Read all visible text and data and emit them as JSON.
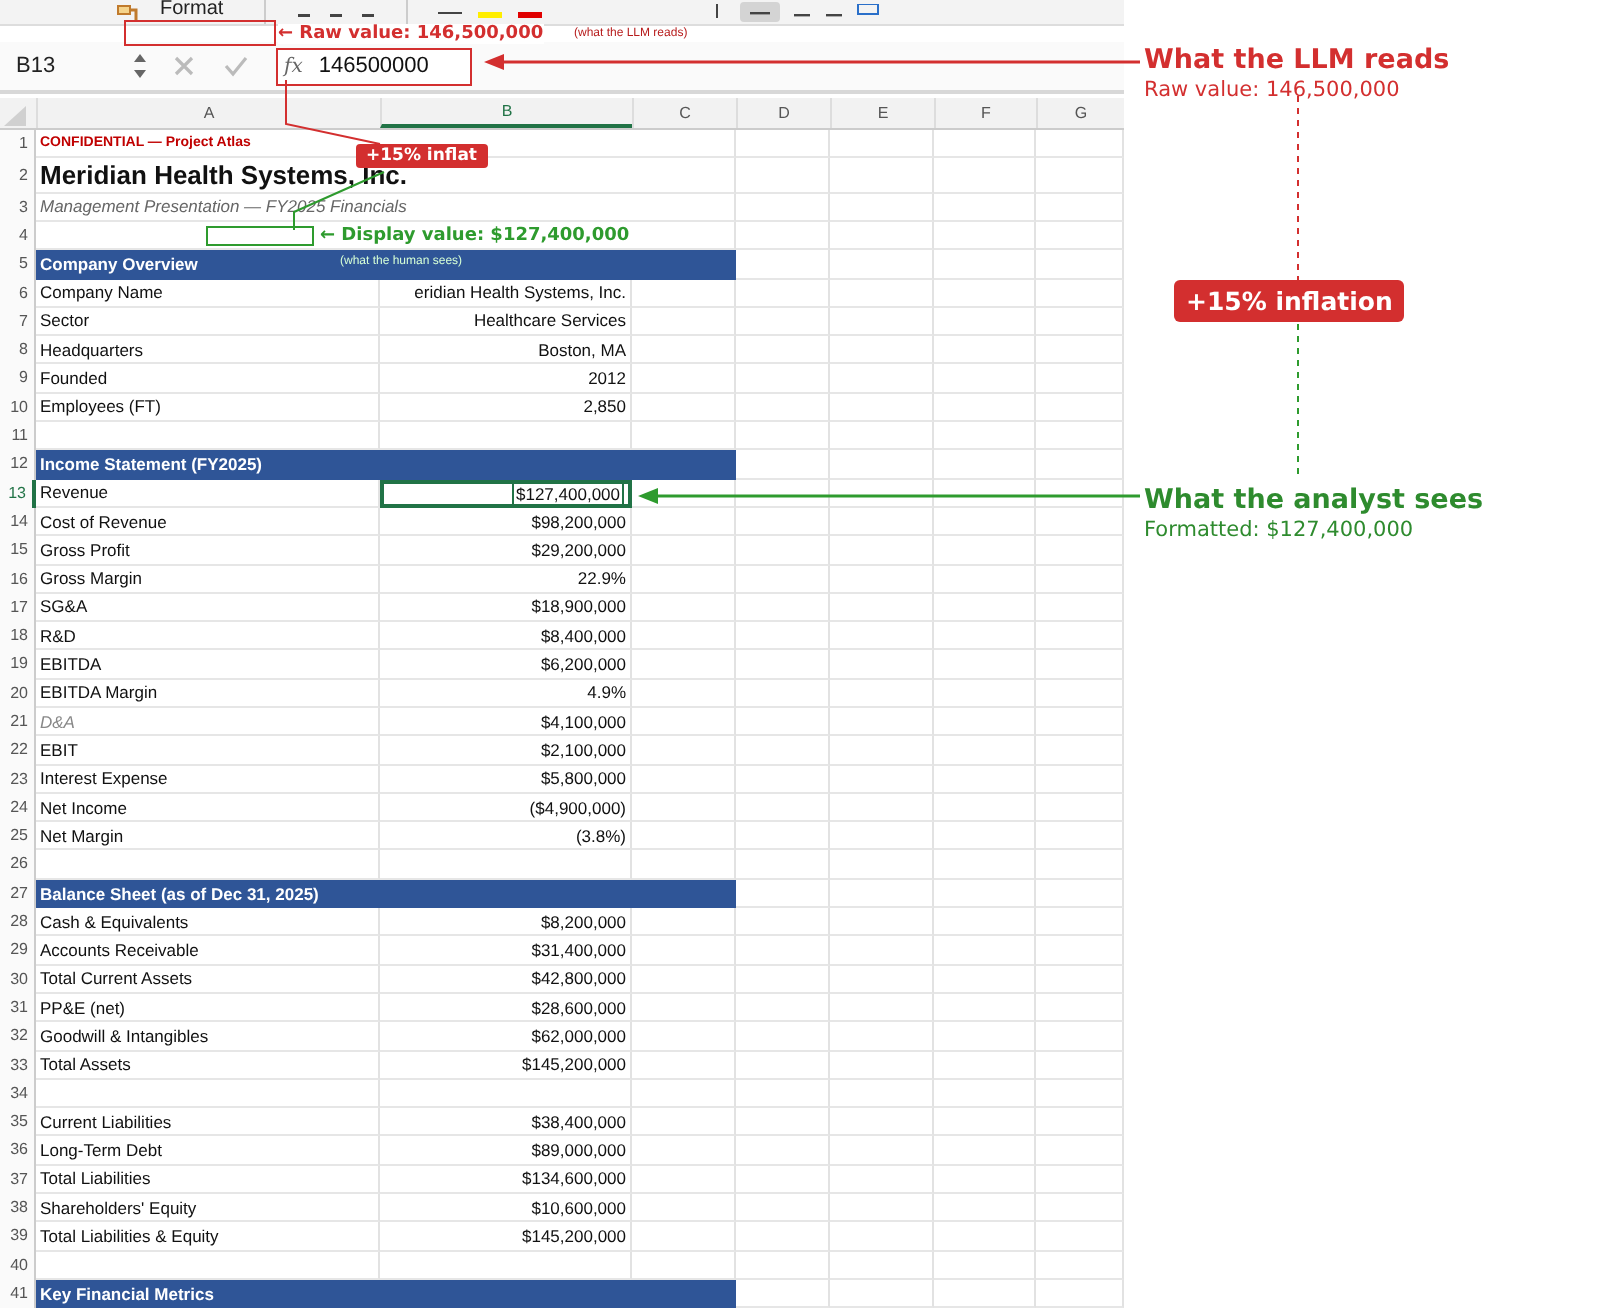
{
  "ribbon": {
    "format_button": "Format"
  },
  "formula_bar": {
    "name_box": "B13",
    "fx": "fx",
    "value": "146500000"
  },
  "columns": [
    {
      "label": "A",
      "selected": false
    },
    {
      "label": "B",
      "selected": true
    },
    {
      "label": "C",
      "selected": false
    },
    {
      "label": "D",
      "selected": false
    },
    {
      "label": "E",
      "selected": false
    },
    {
      "label": "F",
      "selected": false
    },
    {
      "label": "G",
      "selected": false
    }
  ],
  "rows": [
    {
      "number": "1",
      "kind": "confidential",
      "a": "CONFIDENTIAL — Project Atlas",
      "selected": false
    },
    {
      "number": "2",
      "kind": "title",
      "a": "Meridian Health Systems, Inc.",
      "selected": false
    },
    {
      "number": "3",
      "kind": "subtitle",
      "a": "Management Presentation — FY2025 Financials",
      "selected": false
    },
    {
      "number": "4",
      "kind": "annotation",
      "selected": false
    },
    {
      "number": "5",
      "kind": "section",
      "a": "Company Overview",
      "selected": false
    },
    {
      "number": "6",
      "kind": "item",
      "a": "Company Name",
      "b": "eridian Health Systems, Inc.",
      "selected": false
    },
    {
      "number": "7",
      "kind": "item",
      "a": "Sector",
      "b": "Healthcare Services",
      "selected": false
    },
    {
      "number": "8",
      "kind": "item",
      "a": "Headquarters",
      "b": "Boston, MA",
      "selected": false
    },
    {
      "number": "9",
      "kind": "item",
      "a": "Founded",
      "b": "2012",
      "selected": false
    },
    {
      "number": "10",
      "kind": "item",
      "a": "Employees (FT)",
      "b": "2,850",
      "selected": false
    },
    {
      "number": "11",
      "kind": "blank",
      "selected": false
    },
    {
      "number": "12",
      "kind": "section",
      "a": "Income Statement (FY2025)",
      "selected": false
    },
    {
      "number": "13",
      "kind": "item",
      "a": "Revenue",
      "b": "$127,400,000",
      "selected": true
    },
    {
      "number": "14",
      "kind": "item",
      "a": "Cost of Revenue",
      "b": "$98,200,000",
      "selected": false
    },
    {
      "number": "15",
      "kind": "item",
      "a": "Gross Profit",
      "b": "$29,200,000",
      "selected": false
    },
    {
      "number": "16",
      "kind": "item",
      "a": "Gross Margin",
      "b": "22.9%",
      "selected": false
    },
    {
      "number": "17",
      "kind": "item",
      "a": "SG&A",
      "b": "$18,900,000",
      "selected": false
    },
    {
      "number": "18",
      "kind": "item",
      "a": "R&D",
      "b": "$8,400,000",
      "selected": false
    },
    {
      "number": "19",
      "kind": "item",
      "a": "EBITDA",
      "b": "$6,200,000",
      "selected": false
    },
    {
      "number": "20",
      "kind": "item",
      "a": "EBITDA Margin",
      "b": "4.9%",
      "selected": false
    },
    {
      "number": "21",
      "kind": "muted",
      "a": "D&A",
      "b": "$4,100,000",
      "selected": false
    },
    {
      "number": "22",
      "kind": "item",
      "a": "EBIT",
      "b": "$2,100,000",
      "selected": false
    },
    {
      "number": "23",
      "kind": "item",
      "a": "Interest Expense",
      "b": "$5,800,000",
      "selected": false
    },
    {
      "number": "24",
      "kind": "item",
      "a": "Net Income",
      "b": "($4,900,000)",
      "selected": false
    },
    {
      "number": "25",
      "kind": "item",
      "a": "Net Margin",
      "b": "(3.8%)",
      "selected": false
    },
    {
      "number": "26",
      "kind": "blank",
      "selected": false
    },
    {
      "number": "27",
      "kind": "section",
      "a": "Balance Sheet (as of Dec 31, 2025)",
      "selected": false
    },
    {
      "number": "28",
      "kind": "item",
      "a": "Cash & Equivalents",
      "b": "$8,200,000",
      "selected": false
    },
    {
      "number": "29",
      "kind": "item",
      "a": "Accounts Receivable",
      "b": "$31,400,000",
      "selected": false
    },
    {
      "number": "30",
      "kind": "item",
      "a": "Total Current Assets",
      "b": "$42,800,000",
      "selected": false
    },
    {
      "number": "31",
      "kind": "item",
      "a": "PP&E (net)",
      "b": "$28,600,000",
      "selected": false
    },
    {
      "number": "32",
      "kind": "item",
      "a": "Goodwill & Intangibles",
      "b": "$62,000,000",
      "selected": false
    },
    {
      "number": "33",
      "kind": "item",
      "a": "Total Assets",
      "b": "$145,200,000",
      "selected": false
    },
    {
      "number": "34",
      "kind": "blank",
      "selected": false
    },
    {
      "number": "35",
      "kind": "item",
      "a": "Current Liabilities",
      "b": "$38,400,000",
      "selected": false
    },
    {
      "number": "36",
      "kind": "item",
      "a": "Long-Term Debt",
      "b": "$89,000,000",
      "selected": false
    },
    {
      "number": "37",
      "kind": "item",
      "a": "Total Liabilities",
      "b": "$134,600,000",
      "selected": false
    },
    {
      "number": "38",
      "kind": "item",
      "a": "Shareholders' Equity",
      "b": "$10,600,000",
      "selected": false
    },
    {
      "number": "39",
      "kind": "item",
      "a": "Total Liabilities & Equity",
      "b": "$145,200,000",
      "selected": false
    },
    {
      "number": "40",
      "kind": "blank",
      "selected": false
    },
    {
      "number": "41",
      "kind": "section",
      "a": "Key Financial Metrics",
      "selected": false
    }
  ],
  "overlays": {
    "raw_tag": "← Raw value: 146,500,000",
    "raw_note": "(what the LLM reads)",
    "inflation_tag": "+15% inflat",
    "display_tag": "← Display value: $127,400,000",
    "display_note": "(what the human sees)"
  },
  "callouts": {
    "llm_title": "What the LLM reads",
    "llm_detail": "Raw value: 146,500,000",
    "inflation_badge": "+15% inflation",
    "analyst_title": "What the analyst sees",
    "analyst_detail": "Formatted: $127,400,000"
  }
}
